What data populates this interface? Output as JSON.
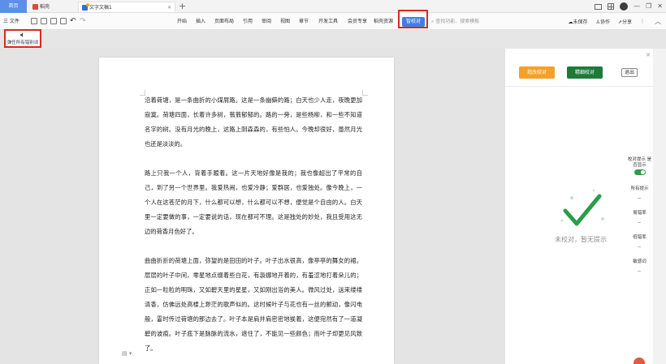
{
  "tabs": {
    "home": "首页",
    "daoke": "稻壳",
    "doc": "文字文稿1",
    "add": "+"
  },
  "ribbon": {
    "file": "三 文件",
    "undo": "↶",
    "redo": "↷",
    "tabs": [
      "开始",
      "插入",
      "页面布局",
      "引用",
      "审阅",
      "视图",
      "章节",
      "开发工具",
      "会员专享",
      "稻壳资源",
      "智校对"
    ],
    "search_placeholder": "查找功能、搜索模板",
    "unsaved": "未保存",
    "collab": "协作",
    "share": "分享"
  },
  "read_aloud": {
    "icon": "speaker-icon",
    "label": "弹任所有错别词"
  },
  "document": {
    "paragraphs": [
      "沿着荷塘，是一条曲折的小煤屑路。这是一条幽僻的路；白天也少人走，夜晚更加寂寞。荷塘四面，长着许多树，蓊蓊郁郁的。路的一旁，是些杨柳，和一些不知道名字的树。没有月光的晚上，这路上阴森森的，有些怕人。今晚却很好，虽然月光也还是淡淡的。",
      "路上只我一个人，背着手踱着。这一片天地好像是我的；我也像超出了平常的自己，到了另一个世界里。我爱热闹，也爱冷静；爱群居，也爱独处。像今晚上，一个人在这苍茫的月下，什么都可以想，什么都可以不想，便觉是个自由的人。白天里一定要做的事，一定要说的话，现在都可不理。这是独处的妙处，我且受用这无边的荷香月色好了。",
      "曲曲折折的荷塘上面，弥望的是田田的叶子。叶子出水很高，像亭亭的舞女的裙。层层的叶子中间，零星地点缀着些白花，有袅娜地开着的，有羞涩地打着朵儿的；正如一粒粒的明珠，又如碧天里的星星，又如刚出浴的美人。微风过处，送来缕缕清香，仿佛远处高楼上渺茫的歌声似的。这时候叶子与花也有一丝的颤动，像闪电般，霎时传过荷塘的那边去了。叶子本是肩并肩密密地挨着，这便宛然有了一道凝碧的波痕。叶子底下是脉脉的流水，遮住了，不能见一些颜色；而叶子却更见风致了。"
    ],
    "status_icon": "doc-status-icon"
  },
  "panel": {
    "btn_orange": "批改校对",
    "btn_green": "精细校对",
    "btn_close": "退出",
    "empty_text": "未校对，暂无提示",
    "rail": {
      "toggle_label": "校对提示 是否显示",
      "all": "所有提示",
      "spelling": "易错率",
      "grammar": "低错率",
      "sensitive": "敏感词"
    }
  },
  "colors": {
    "accent_blue": "#3f7fe4",
    "highlight_red": "#d62a23",
    "orange": "#f5a02b",
    "green": "#1f7a3a"
  }
}
